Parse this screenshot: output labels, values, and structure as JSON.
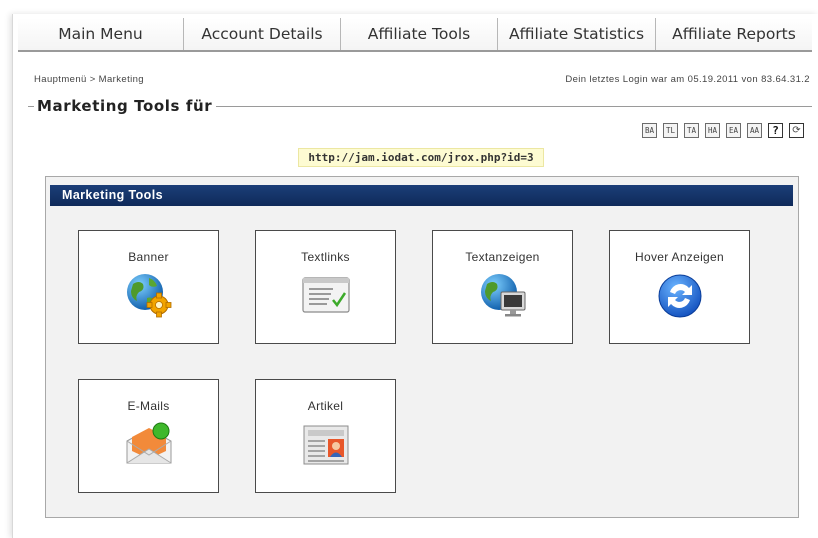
{
  "nav": {
    "items": [
      {
        "label": "Main Menu"
      },
      {
        "label": "Account Details"
      },
      {
        "label": "Affiliate Tools"
      },
      {
        "label": "Affiliate Statistics"
      },
      {
        "label": "Affiliate Reports"
      }
    ]
  },
  "breadcrumb": {
    "home": "Hauptmenü",
    "separator": ">",
    "current": "Marketing"
  },
  "last_login": "Dein letztes Login war am 05.19.2011 von 83.64.31.2",
  "section": {
    "title": "Marketing Tools für"
  },
  "toolbar": {
    "items": [
      {
        "label": "BA",
        "icon": "banner-ad-icon"
      },
      {
        "label": "TL",
        "icon": "textlink-icon"
      },
      {
        "label": "TA",
        "icon": "textad-icon"
      },
      {
        "label": "HA",
        "icon": "hover-ad-icon"
      },
      {
        "label": "EA",
        "icon": "email-ad-icon"
      },
      {
        "label": "AA",
        "icon": "article-ad-icon"
      },
      {
        "label": "?",
        "icon": "help-icon"
      },
      {
        "label": "⟳",
        "icon": "refresh-icon"
      }
    ]
  },
  "affiliate_url": "http://jam.iodat.com/jrox.php?id=3",
  "panel": {
    "title": "Marketing Tools"
  },
  "tools": [
    {
      "label": "Banner",
      "icon": "globe-gear-icon"
    },
    {
      "label": "Textlinks",
      "icon": "text-document-check-icon"
    },
    {
      "label": "Textanzeigen",
      "icon": "globe-monitor-icon"
    },
    {
      "label": "Hover Anzeigen",
      "icon": "blue-circular-arrows-icon"
    },
    {
      "label": "E-Mails",
      "icon": "envelope-add-icon"
    },
    {
      "label": "Artikel",
      "icon": "newspaper-article-icon"
    }
  ],
  "colors": {
    "panel_header": "#0f2a5a",
    "url_highlight": "#fdfbd2"
  }
}
